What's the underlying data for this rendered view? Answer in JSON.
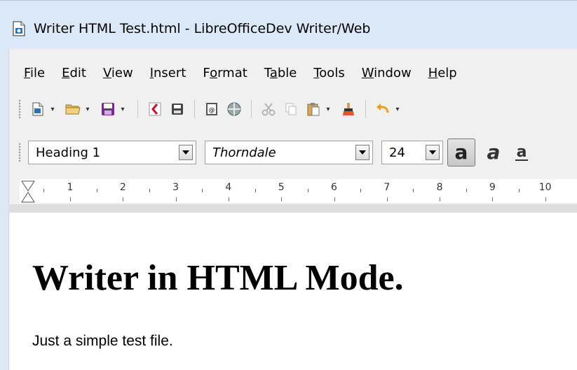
{
  "window": {
    "title": "Writer HTML Test.html - LibreOfficeDev Writer/Web"
  },
  "menubar": {
    "items": [
      {
        "pre": "",
        "ul": "F",
        "post": "ile"
      },
      {
        "pre": "",
        "ul": "E",
        "post": "dit"
      },
      {
        "pre": "",
        "ul": "V",
        "post": "iew"
      },
      {
        "pre": "",
        "ul": "I",
        "post": "nsert"
      },
      {
        "pre": "F",
        "ul": "o",
        "post": "rmat"
      },
      {
        "pre": "T",
        "ul": "a",
        "post": "ble"
      },
      {
        "pre": "",
        "ul": "T",
        "post": "ools"
      },
      {
        "pre": "",
        "ul": "W",
        "post": "indow"
      },
      {
        "pre": "",
        "ul": "H",
        "post": "elp"
      }
    ]
  },
  "formatting": {
    "paragraph_style": "Heading 1",
    "font_name": "Thorndale",
    "font_size": "24"
  },
  "ruler": {
    "labels": [
      "1",
      "2",
      "3",
      "4",
      "5",
      "6",
      "7",
      "8",
      "9",
      "10"
    ]
  },
  "document": {
    "heading": "Writer in HTML Mode.",
    "paragraph": "Just a simple test file."
  },
  "colors": {
    "titlebar": "#dbe8f7",
    "chrome": "#f0f0f0",
    "save_purple": "#7b2a8e",
    "pdf_red": "#c8102e"
  }
}
